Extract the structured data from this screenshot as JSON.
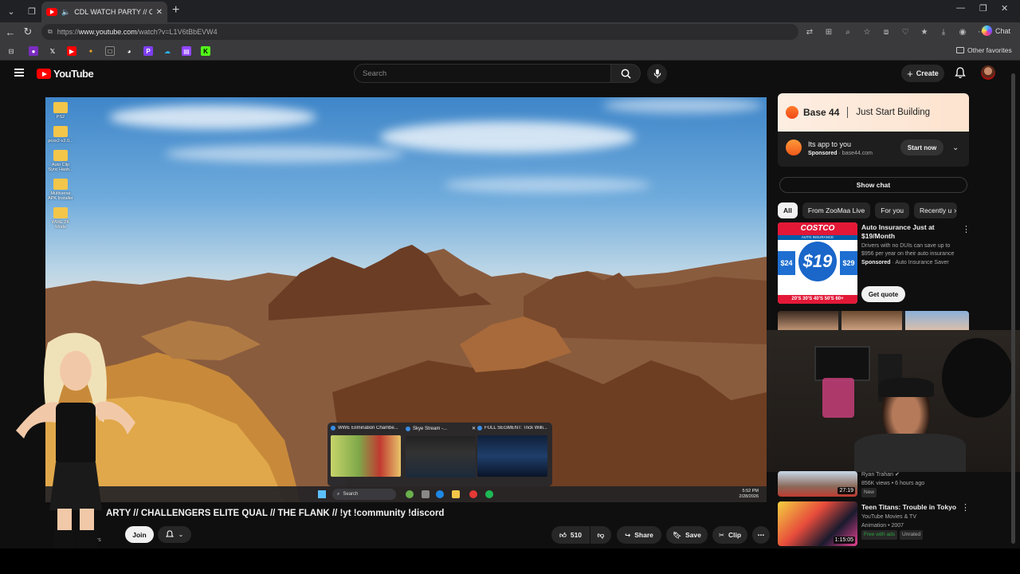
{
  "browser": {
    "tab_title": "CDL WATCH PARTY // CHALLE",
    "url_prefix": "https://",
    "url_domain": "www.youtube.com",
    "url_path": "/watch?v=L1V6tBbEVW4",
    "chat_label": "Chat",
    "other_favorites": "Other favorites"
  },
  "youtube": {
    "logo_text": "YouTube",
    "search_placeholder": "Search",
    "create_label": "Create"
  },
  "video": {
    "desktop_icons": [
      "PS2",
      "pcsx2-v2.0...",
      "Auto Clip Sync Hash...",
      "Multiverse APK Installer",
      "WWE 2K Mods"
    ],
    "taskbar_search": "Search",
    "clock_time": "5:52 PM",
    "clock_date": "2/28/2026",
    "thumbnails": [
      {
        "title": "WWE Elimination Chambe..."
      },
      {
        "title": "Skye Stream -..."
      },
      {
        "title": "FULL SEGMENT: Trick Willi..."
      }
    ]
  },
  "below_video": {
    "title": "ARTY // CHALLENGERS ELITE QUAL // THE FLANK // !yt !community !discord",
    "subscribers": "ers",
    "join_label": "Join",
    "likes": "510",
    "share_label": "Share",
    "save_label": "Save",
    "clip_label": "Clip"
  },
  "sidebar": {
    "ad1": {
      "brand": "Base 44",
      "tagline": "Just Start Building",
      "headline": "Its app to you",
      "sponsored": "Sponsored",
      "domain": "base44.com",
      "cta": "Start now"
    },
    "show_chat": "Show chat",
    "chips": [
      "All",
      "From ZooMaa Live",
      "For you",
      "Recently u"
    ],
    "ad2": {
      "title": "Auto Insurance Just at $19/Month",
      "desc": "Drivers with no DUIs can save up to $956 per year on their auto insurance",
      "sponsored": "Sponsored",
      "advertiser": "Auto Insurance Saver",
      "cta": "Get quote",
      "img_brand": "COSTCO",
      "img_sub": "AUTO INSURANCE",
      "img_price": "$19",
      "img_price_left": "$24",
      "img_price_right": "$29",
      "img_ages": "20'S 30'S 40'S 50'S 60+"
    },
    "rec1": {
      "duration": "27:19",
      "channel": "Ryan Trahan",
      "meta": "856K views • 6 hours ago",
      "badge": "New"
    },
    "rec2": {
      "title": "Teen Titans: Trouble in Tokyo",
      "channel": "YouTube Movies & TV",
      "meta": "Animation • 2007",
      "duration": "1:15:05",
      "badge1": "Free with ads",
      "badge2": "Unrated"
    }
  },
  "colors": {
    "brand_red": "#ff0000",
    "page_bg": "#0f0f0f",
    "chip_bg": "#272727"
  }
}
